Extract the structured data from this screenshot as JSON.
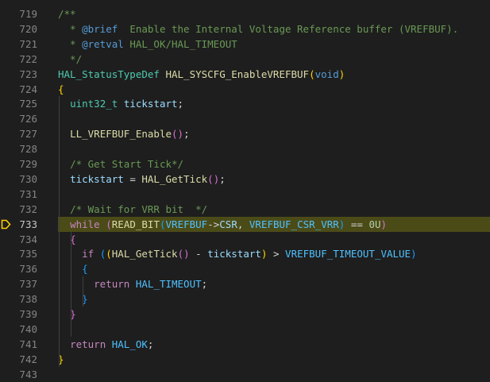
{
  "editor": {
    "lines": [
      {
        "num": "719",
        "tokens": [
          {
            "t": "/**",
            "c": "cm"
          }
        ]
      },
      {
        "num": "720",
        "tokens": [
          {
            "t": "  * ",
            "c": "cm"
          },
          {
            "t": "@brief",
            "c": "doc"
          },
          {
            "t": "  Enable the Internal Voltage Reference buffer (VREFBUF).",
            "c": "cm"
          }
        ]
      },
      {
        "num": "721",
        "tokens": [
          {
            "t": "  * ",
            "c": "cm"
          },
          {
            "t": "@retval",
            "c": "doc"
          },
          {
            "t": " HAL_OK/HAL_TIMEOUT",
            "c": "cm"
          }
        ]
      },
      {
        "num": "722",
        "tokens": [
          {
            "t": "  */",
            "c": "cm"
          }
        ]
      },
      {
        "num": "723",
        "tokens": [
          {
            "t": "HAL_StatusTypeDef",
            "c": "tp"
          },
          {
            "t": " ",
            "c": "pn"
          },
          {
            "t": "HAL_SYSCFG_EnableVREFBUF",
            "c": "fn"
          },
          {
            "t": "(",
            "c": "br1"
          },
          {
            "t": "void",
            "c": "kw2"
          },
          {
            "t": ")",
            "c": "br1"
          }
        ]
      },
      {
        "num": "724",
        "tokens": [
          {
            "t": "{",
            "c": "br1"
          }
        ]
      },
      {
        "num": "725",
        "tokens": [
          {
            "t": "  ",
            "c": "pn"
          },
          {
            "t": "uint32_t",
            "c": "tp"
          },
          {
            "t": " ",
            "c": "pn"
          },
          {
            "t": "tickstart",
            "c": "var"
          },
          {
            "t": ";",
            "c": "pn"
          }
        ]
      },
      {
        "num": "726",
        "tokens": []
      },
      {
        "num": "727",
        "tokens": [
          {
            "t": "  ",
            "c": "pn"
          },
          {
            "t": "LL_VREFBUF_Enable",
            "c": "fn"
          },
          {
            "t": "(",
            "c": "br2"
          },
          {
            "t": ")",
            "c": "br2"
          },
          {
            "t": ";",
            "c": "pn"
          }
        ]
      },
      {
        "num": "728",
        "tokens": []
      },
      {
        "num": "729",
        "tokens": [
          {
            "t": "  ",
            "c": "pn"
          },
          {
            "t": "/* Get Start Tick*/",
            "c": "cm"
          }
        ]
      },
      {
        "num": "730",
        "tokens": [
          {
            "t": "  ",
            "c": "pn"
          },
          {
            "t": "tickstart",
            "c": "var"
          },
          {
            "t": " = ",
            "c": "pn"
          },
          {
            "t": "HAL_GetTick",
            "c": "fn"
          },
          {
            "t": "(",
            "c": "br2"
          },
          {
            "t": ")",
            "c": "br2"
          },
          {
            "t": ";",
            "c": "pn"
          }
        ]
      },
      {
        "num": "731",
        "tokens": []
      },
      {
        "num": "732",
        "tokens": [
          {
            "t": "  ",
            "c": "pn"
          },
          {
            "t": "/* Wait for VRR bit  */",
            "c": "cm"
          }
        ]
      },
      {
        "num": "733",
        "active": true,
        "tokens": [
          {
            "t": "  ",
            "c": "pn"
          },
          {
            "t": "while",
            "c": "kw"
          },
          {
            "t": " ",
            "c": "pn"
          },
          {
            "t": "(",
            "c": "br2"
          },
          {
            "t": "READ_BIT",
            "c": "fn"
          },
          {
            "t": "(",
            "c": "br3"
          },
          {
            "t": "VREFBUF",
            "c": "mac"
          },
          {
            "t": "->",
            "c": "acc"
          },
          {
            "t": "CSR",
            "c": "var"
          },
          {
            "t": ", ",
            "c": "pn"
          },
          {
            "t": "VREFBUF_CSR_VRR",
            "c": "mac"
          },
          {
            "t": ")",
            "c": "br3"
          },
          {
            "t": " == ",
            "c": "pn"
          },
          {
            "t": "0U",
            "c": "num"
          },
          {
            "t": ")",
            "c": "br2"
          }
        ]
      },
      {
        "num": "734",
        "tokens": [
          {
            "t": "  ",
            "c": "pn"
          },
          {
            "t": "{",
            "c": "br2"
          }
        ]
      },
      {
        "num": "735",
        "tokens": [
          {
            "t": "    ",
            "c": "pn"
          },
          {
            "t": "if",
            "c": "kw"
          },
          {
            "t": " ",
            "c": "pn"
          },
          {
            "t": "(",
            "c": "br3"
          },
          {
            "t": "(",
            "c": "br1"
          },
          {
            "t": "HAL_GetTick",
            "c": "fn"
          },
          {
            "t": "(",
            "c": "br2"
          },
          {
            "t": ")",
            "c": "br2"
          },
          {
            "t": " - ",
            "c": "pn"
          },
          {
            "t": "tickstart",
            "c": "var"
          },
          {
            "t": ")",
            "c": "br1"
          },
          {
            "t": " > ",
            "c": "pn"
          },
          {
            "t": "VREFBUF_TIMEOUT_VALUE",
            "c": "mac"
          },
          {
            "t": ")",
            "c": "br3"
          }
        ]
      },
      {
        "num": "736",
        "tokens": [
          {
            "t": "    ",
            "c": "pn"
          },
          {
            "t": "{",
            "c": "br3"
          }
        ]
      },
      {
        "num": "737",
        "tokens": [
          {
            "t": "      ",
            "c": "pn"
          },
          {
            "t": "return",
            "c": "kw"
          },
          {
            "t": " ",
            "c": "pn"
          },
          {
            "t": "HAL_TIMEOUT",
            "c": "mac"
          },
          {
            "t": ";",
            "c": "pn"
          }
        ]
      },
      {
        "num": "738",
        "tokens": [
          {
            "t": "    ",
            "c": "pn"
          },
          {
            "t": "}",
            "c": "br3"
          }
        ]
      },
      {
        "num": "739",
        "tokens": [
          {
            "t": "  ",
            "c": "pn"
          },
          {
            "t": "}",
            "c": "br2"
          }
        ]
      },
      {
        "num": "740",
        "tokens": []
      },
      {
        "num": "741",
        "tokens": [
          {
            "t": "  ",
            "c": "pn"
          },
          {
            "t": "return",
            "c": "kw"
          },
          {
            "t": " ",
            "c": "pn"
          },
          {
            "t": "HAL_OK",
            "c": "mac"
          },
          {
            "t": ";",
            "c": "pn"
          }
        ]
      },
      {
        "num": "742",
        "tokens": [
          {
            "t": "}",
            "c": "br1"
          }
        ]
      },
      {
        "num": "743",
        "tokens": []
      }
    ],
    "breakpoint_line": "733",
    "colors": {
      "background": "#1e1e1e",
      "current_line": "#4b4b18",
      "breakpoint_arrow": "#ffcc00"
    }
  }
}
